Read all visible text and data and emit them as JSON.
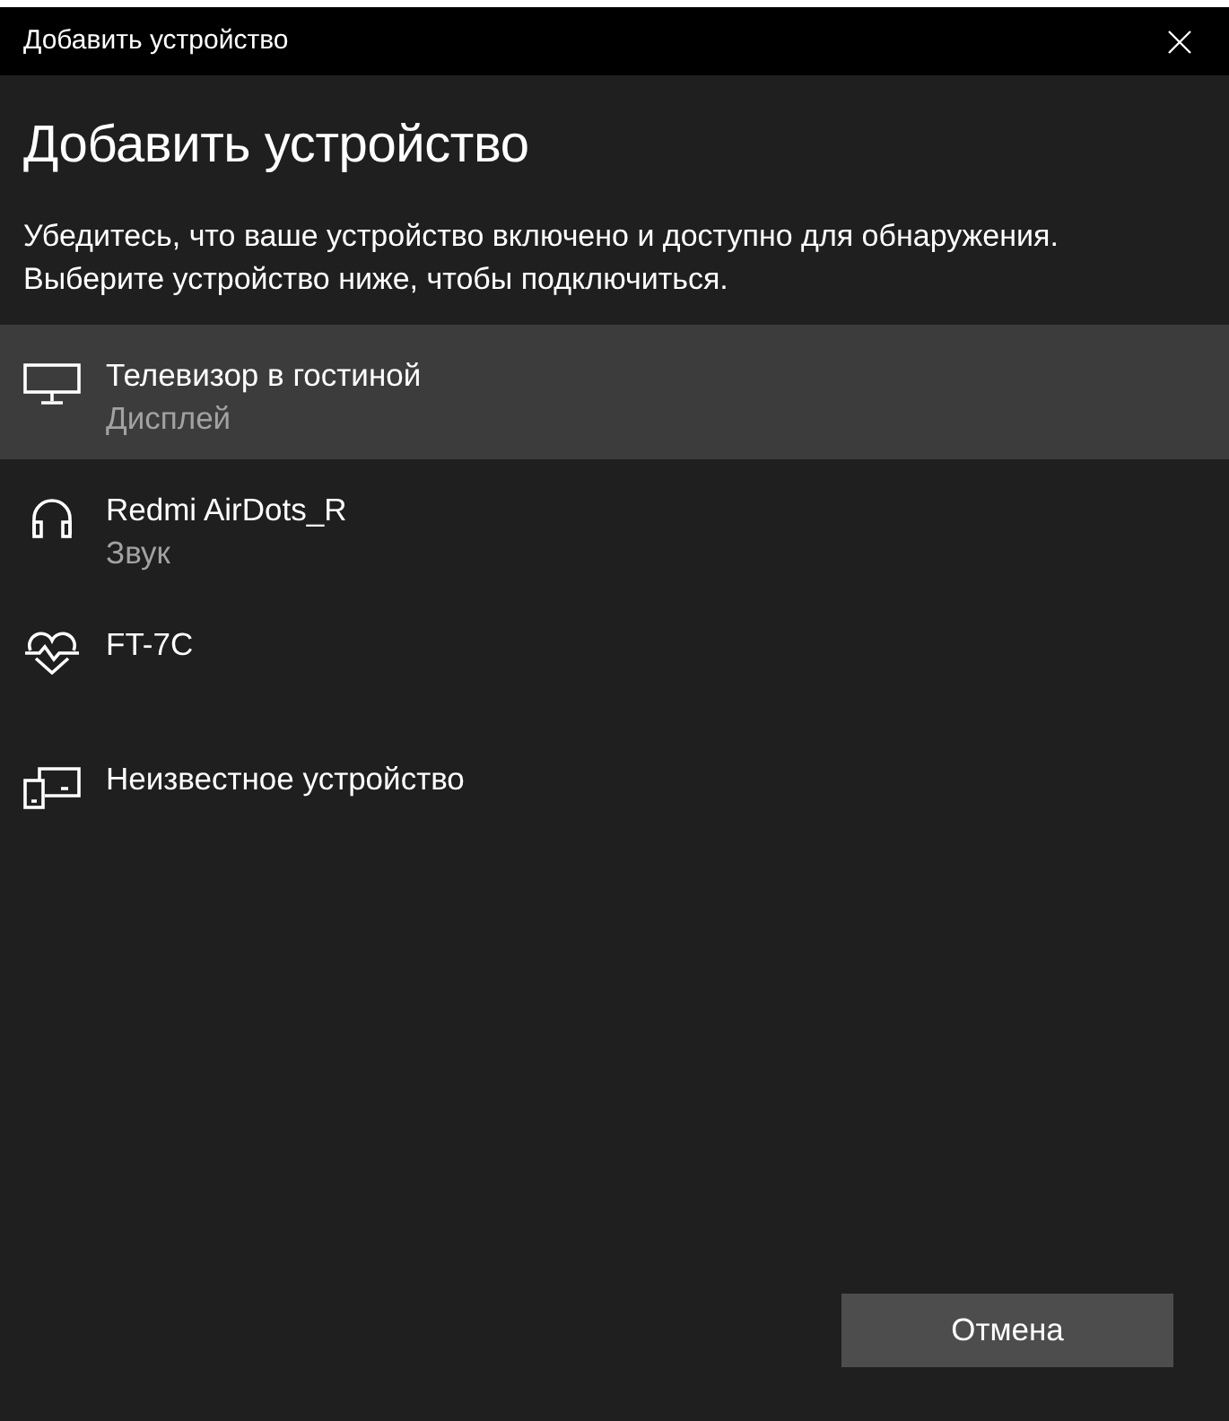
{
  "window": {
    "title": "Добавить устройство"
  },
  "heading": "Добавить устройство",
  "instructions": [
    "Убедитесь, что ваше устройство включено и доступно для обнаружения.",
    "Выберите устройство ниже, чтобы подключиться."
  ],
  "devices": [
    {
      "name": "Телевизор в гостиной",
      "category": "Дисплей",
      "kind": "display",
      "selected": true
    },
    {
      "name": "Redmi AirDots_R",
      "category": "Звук",
      "kind": "audio",
      "selected": false
    },
    {
      "name": "FT-7C",
      "kind": "fitness",
      "selected": false
    },
    {
      "name": "Неизвестное устройство",
      "kind": "other",
      "selected": false
    }
  ],
  "buttons": [
    {
      "label": "Отмена"
    }
  ]
}
